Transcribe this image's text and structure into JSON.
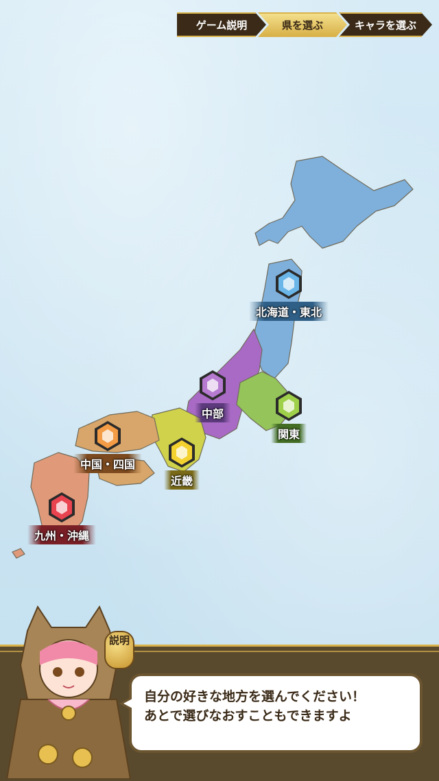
{
  "steps": [
    {
      "label": "ゲーム説明",
      "active": false
    },
    {
      "label": "県を選ぶ",
      "active": true
    },
    {
      "label": "キャラを選ぶ",
      "active": false
    }
  ],
  "regions": {
    "hokkaido_tohoku": {
      "label": "北海道・東北",
      "color": "#6ab6e8"
    },
    "chubu": {
      "label": "中部",
      "color": "#b67bd1"
    },
    "kanto": {
      "label": "関東",
      "color": "#9ed04a"
    },
    "kinki": {
      "label": "近畿",
      "color": "#f3d230"
    },
    "chugoku_shikoku": {
      "label": "中国・四国",
      "color": "#f39b45"
    },
    "kyushu_okinawa": {
      "label": "九州・沖縄",
      "color": "#e8434f"
    }
  },
  "badge": {
    "label": "説明"
  },
  "dialog": {
    "line1": "自分の好きな地方を選んでください！",
    "line2": "あとで選びなおすこともできますよ"
  }
}
